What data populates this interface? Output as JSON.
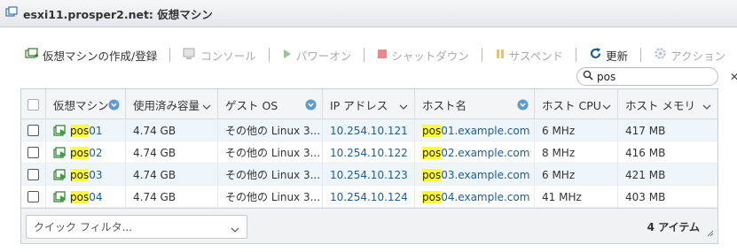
{
  "window": {
    "title": "esxi11.prosper2.net: 仮想マシン"
  },
  "toolbar": {
    "items": [
      {
        "label": "仮想マシンの作成/登録",
        "icon": "create-vm-icon",
        "enabled": true
      },
      {
        "label": "コンソール",
        "icon": "console-icon",
        "enabled": false
      },
      {
        "label": "パワーオン",
        "icon": "play-icon",
        "enabled": false
      },
      {
        "label": "シャットダウン",
        "icon": "stop-icon",
        "enabled": false
      },
      {
        "label": "サスペンド",
        "icon": "pause-icon",
        "enabled": false
      },
      {
        "label": "更新",
        "icon": "refresh-icon",
        "enabled": true
      },
      {
        "label": "アクション",
        "icon": "gear-icon",
        "enabled": false
      }
    ]
  },
  "search": {
    "value": "pos"
  },
  "table": {
    "columns": [
      "仮想マシン",
      "使用済み容量",
      "ゲスト OS",
      "IP アドレス",
      "ホスト名",
      "ホスト CPU",
      "ホスト メモリ"
    ],
    "rows": [
      {
        "highlight": "pos",
        "vm_suffix": "01",
        "used": "4.74 GB",
        "os": "その他の Linux 3...",
        "ip": "10.254.10.121",
        "host_suffix": "01.example.com",
        "cpu": "6 MHz",
        "mem": "417 MB"
      },
      {
        "highlight": "pos",
        "vm_suffix": "02",
        "used": "4.74 GB",
        "os": "その他の Linux 3...",
        "ip": "10.254.10.122",
        "host_suffix": "02.example.com",
        "cpu": "8 MHz",
        "mem": "416 MB"
      },
      {
        "highlight": "pos",
        "vm_suffix": "03",
        "used": "4.74 GB",
        "os": "その他の Linux 3...",
        "ip": "10.254.10.123",
        "host_suffix": "03.example.com",
        "cpu": "6 MHz",
        "mem": "421 MB"
      },
      {
        "highlight": "pos",
        "vm_suffix": "04",
        "used": "4.74 GB",
        "os": "その他の Linux 3...",
        "ip": "10.254.10.124",
        "host_suffix": "04.example.com",
        "cpu": "41 MHz",
        "mem": "403 MB"
      }
    ]
  },
  "footer": {
    "filter_placeholder": "クイック フィルタ...",
    "count": "4 アイテム"
  },
  "colors": {
    "accent": "#1a5d9c",
    "highlight": "#ffff33",
    "stripe": "#eef5fb"
  }
}
